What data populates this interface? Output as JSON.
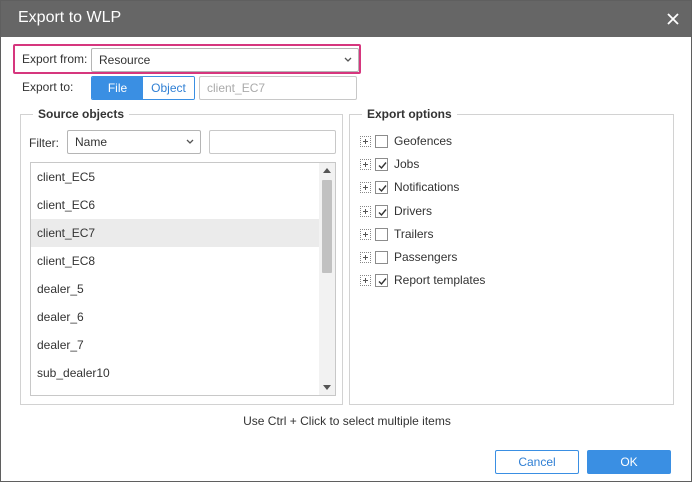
{
  "dialog": {
    "title": "Export to WLP"
  },
  "export_from": {
    "label": "Export from:",
    "value": "Resource"
  },
  "export_to": {
    "label": "Export to:",
    "options": [
      "File",
      "Object"
    ],
    "selected": "File",
    "object_value": "client_EC7"
  },
  "source_objects": {
    "legend": "Source objects",
    "filter_label": "Filter:",
    "filter_value": "Name",
    "filter_text": "",
    "items": [
      "client_EC5",
      "client_EC6",
      "client_EC7",
      "client_EC8",
      "dealer_5",
      "dealer_6",
      "dealer_7",
      "sub_dealer10"
    ],
    "selected": "client_EC7"
  },
  "export_options": {
    "legend": "Export options",
    "items": [
      {
        "label": "Geofences",
        "checked": false
      },
      {
        "label": "Jobs",
        "checked": true
      },
      {
        "label": "Notifications",
        "checked": true
      },
      {
        "label": "Drivers",
        "checked": true
      },
      {
        "label": "Trailers",
        "checked": false
      },
      {
        "label": "Passengers",
        "checked": false
      },
      {
        "label": "Report templates",
        "checked": true
      }
    ]
  },
  "hint": "Use Ctrl + Click to select multiple items",
  "buttons": {
    "cancel": "Cancel",
    "ok": "OK"
  },
  "colors": {
    "titlebar": "#666666",
    "accent": "#3a8fe3",
    "highlight": "#d6367e",
    "selected_row": "#ebebeb"
  }
}
